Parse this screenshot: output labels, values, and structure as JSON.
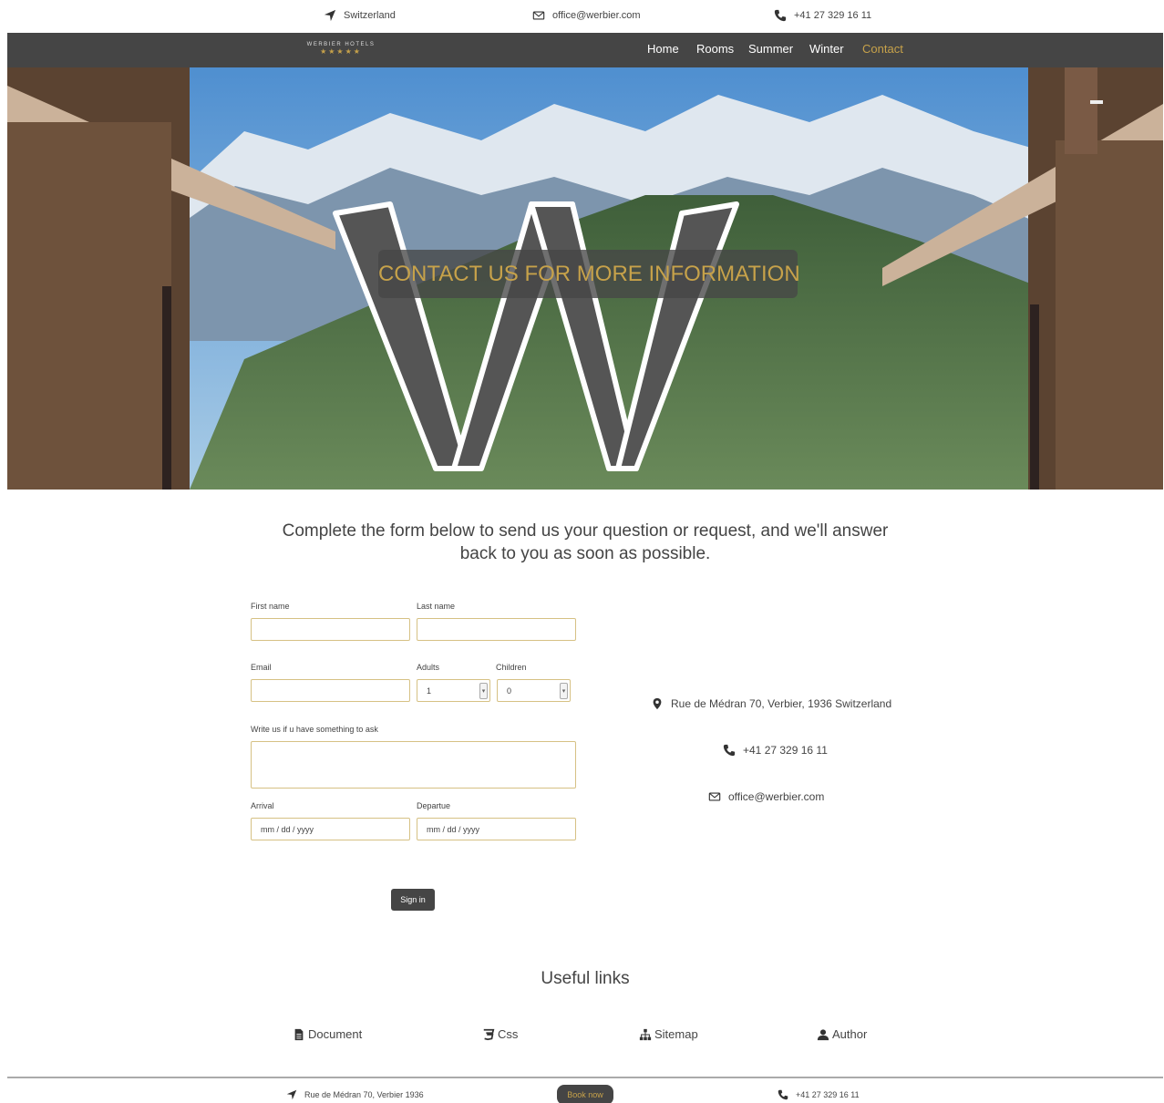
{
  "topbar": {
    "location": "Switzerland",
    "email": "office@werbier.com",
    "phone": "+41 27 329 16 11"
  },
  "brand": {
    "name": "WERBIER HOTELS",
    "stars": "★★★★★"
  },
  "nav": [
    {
      "label": "Home"
    },
    {
      "label": "Rooms"
    },
    {
      "label": "Summer"
    },
    {
      "label": "Winter"
    },
    {
      "label": "Contact"
    }
  ],
  "hero": {
    "title": "CONTACT US FOR MORE INFORMATION"
  },
  "intro": "Complete the form below to send us your question or request, and we'll answer back to you as soon as possible.",
  "form": {
    "first_name_label": "First name",
    "last_name_label": "Last name",
    "email_label": "Email",
    "adults_label": "Adults",
    "adults_value": "1",
    "children_label": "Children",
    "children_value": "0",
    "message_label": "Write us if u have something to ask",
    "arrival_label": "Arrival",
    "arrival_placeholder": "mm / dd / yyyy",
    "departure_label": "Departue",
    "departure_placeholder": "mm / dd / yyyy",
    "submit_label": "Sign in"
  },
  "contact": {
    "address": "Rue de Médran 70, Verbier, 1936 Switzerland",
    "phone": "+41 27 329 16 11",
    "email": "office@werbier.com"
  },
  "useful": {
    "title": "Useful links",
    "links": [
      {
        "label": "Document",
        "icon": "document-icon"
      },
      {
        "label": "Css",
        "icon": "css-icon"
      },
      {
        "label": "Sitemap",
        "icon": "sitemap-icon"
      },
      {
        "label": "Author",
        "icon": "user-icon"
      }
    ]
  },
  "footer": {
    "address": "Rue de Médran 70, Verbier 1936",
    "book_label": "Book now",
    "phone": "+41 27 329 16 11"
  },
  "colors": {
    "accent": "#c7a24a",
    "dark": "#454545",
    "sky": "#6fa0c8"
  }
}
